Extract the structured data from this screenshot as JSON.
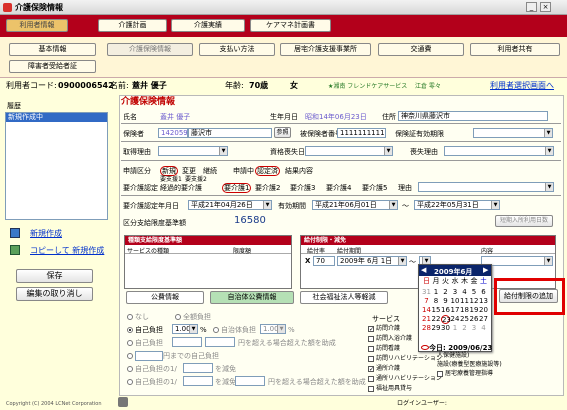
{
  "window": {
    "title": "介護保険情報"
  },
  "main_tabs": [
    "利用者情報",
    "介護計画",
    "介護実績",
    "ケアマネ計画書"
  ],
  "sub_tabs": [
    "基本情報",
    "介護保険情報",
    "支払い方法",
    "居宅介護支援事業所",
    "交通費",
    "利用者共有",
    "障害者受給者証"
  ],
  "user_bar": {
    "code_label": "利用者コード:",
    "code_value": "0900006542",
    "name_label": "名前:",
    "name_value": "蓋井 優子",
    "age_label": "年齢:",
    "age_value": "70歳",
    "sex": "女",
    "facility": "★湘南 フレンドケアサービス",
    "staff": "江倉 零々",
    "back_link": "利用者選択画面へ"
  },
  "sidebar": {
    "history_label": "履歴",
    "history_item": "新規作成中",
    "new_link": "新規作成",
    "copy_link": "コピーして 新規作成",
    "save_button": "保存",
    "cancel_button": "編集の取り消し"
  },
  "insurance": {
    "section_title": "介護保険情報",
    "name_label": "氏名",
    "name_value": "蓋井 優子",
    "birth_label": "生年月日",
    "birth_value": "昭和14年06月23日",
    "address_label": "住所",
    "address_value": "神奈川県藤沢市",
    "insurer_label": "保険者",
    "insurer_code": "142059",
    "insurer_city": "藤沢市",
    "ref_button": "参照",
    "insured_no_label": "被保険者番号",
    "insured_no_value": "1111111111",
    "cert_expiry_label": "保険証有効期限",
    "acquire_reason_label": "取得理由",
    "qualify_date_label": "資格喪失日",
    "loss_reason_label": "喪失理由",
    "apply_label": "申請区分",
    "apply_options": [
      "新規",
      "変更",
      "継続"
    ],
    "apply_status_label": "申請中",
    "apply_status_value": "認定済",
    "result_label": "結果内容",
    "care_level_label": "要介護認定",
    "care_levels_top": [
      "要支援1",
      "要支援2"
    ],
    "care_levels": [
      "経過的要介護",
      "要介護1",
      "要介護2",
      "要介護3",
      "要介護4",
      "要介護5"
    ],
    "reason_label": "理由",
    "cert_date_label": "要介護認定年月日",
    "cert_date_value": "平成21年04月26日",
    "valid_label": "有効期間",
    "valid_from": "平成21年06月01日",
    "valid_to": "平成22年05月31日",
    "tilde": "～",
    "limit_label": "区分支給限度基準額",
    "limit_value": "16580",
    "limit_button": "短期入所利用日数"
  },
  "special_panel": {
    "title": "種類支給限度基準額",
    "col1": "サービスの種類",
    "col2": "限度額"
  },
  "benefit_panel": {
    "title": "給付制限・減免",
    "col1": "給付率",
    "col2": "給付期間",
    "col3": "内容",
    "rate_value": "70",
    "period_from": "2009年 6月 1日",
    "period_sep": "～",
    "add_button": "給付制限の追加"
  },
  "calendar": {
    "month_label": "2009年6月",
    "weekdays": [
      "日",
      "月",
      "火",
      "水",
      "木",
      "金",
      "土"
    ],
    "rows": [
      [
        "31",
        "1",
        "2",
        "3",
        "4",
        "5",
        "6"
      ],
      [
        "7",
        "8",
        "9",
        "10",
        "11",
        "12",
        "13"
      ],
      [
        "14",
        "15",
        "16",
        "17",
        "18",
        "19",
        "20"
      ],
      [
        "21",
        "22",
        "23",
        "24",
        "25",
        "26",
        "27"
      ],
      [
        "28",
        "29",
        "30",
        "1",
        "2",
        "3",
        "4"
      ]
    ],
    "today_label": "今日: 2009/06/23"
  },
  "bottom_tabs": [
    "公費情報",
    "自治体公費情報",
    "社会福祉法人等軽減"
  ],
  "burden": {
    "none_label": "なし",
    "full_label": "全額負担",
    "self_label": "自己負担",
    "self_value": "1.00",
    "local_label": "自治体負担",
    "local_value": "1.00",
    "percent": "%",
    "self2_label": "自己負担",
    "range_text": "円を超える場合超えた額を助成",
    "fixed_label": "円までの自己負担",
    "burden_frac_label": "自己負担の1/",
    "assist_label": "を減免",
    "assist2_label": "を減免",
    "range_text2": "円を超える場合超えた額を助成"
  },
  "services": {
    "title": "サービス",
    "items": [
      {
        "label": "訪問介護",
        "checked": true
      },
      {
        "label": "訪問入浴介護",
        "checked": false
      },
      {
        "label": "訪問看護",
        "checked": false
      },
      {
        "label": "訪問リハビリテーション",
        "checked": false
      },
      {
        "label": "通所介護",
        "checked": true
      },
      {
        "label": "通所リハビリテーション",
        "checked": false
      },
      {
        "label": "福祉用具貸与",
        "checked": false
      }
    ],
    "right_items": [
      "人保健施設)",
      "施設(療養型医療施設等)",
      "居宅療養管理指導"
    ]
  },
  "footer": {
    "copyright": "Copyright (C) 2004 LCNet Corporation",
    "login": "ログインユーザー:"
  },
  "colors": {
    "brand_red": "#b3001b",
    "highlight_box": "#e00000",
    "bg": "#ffffdc"
  }
}
